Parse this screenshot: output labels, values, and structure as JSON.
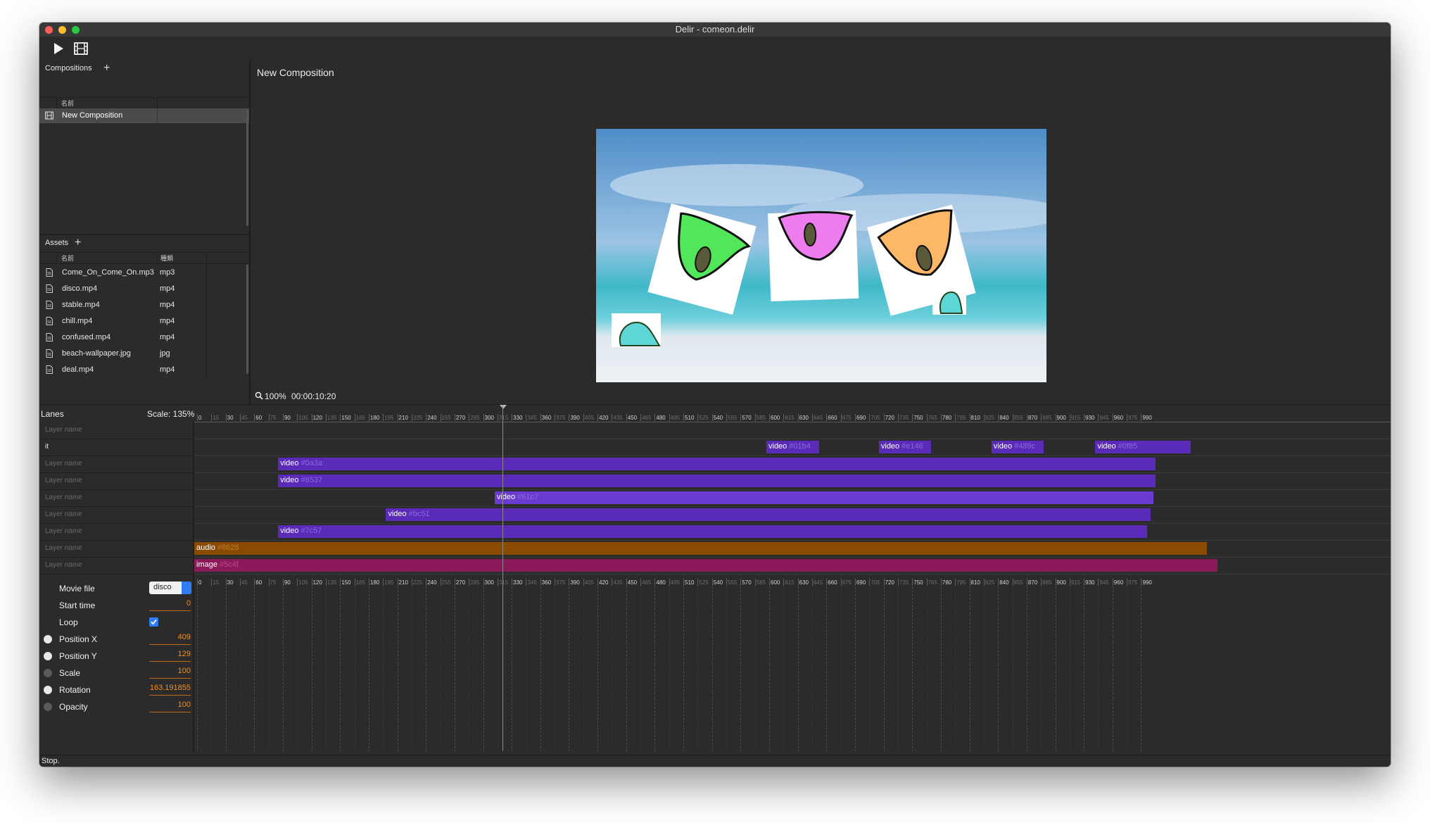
{
  "window": {
    "title": "Delir - comeon.delir"
  },
  "toolbar": {
    "play_icon": "play-icon",
    "render_icon": "film-icon"
  },
  "compositions": {
    "header": "Compositions",
    "add_label": "+",
    "column_name": "名前",
    "items": [
      {
        "name": "New Composition"
      }
    ]
  },
  "assets": {
    "header": "Assets",
    "add_label": "+",
    "columns": {
      "name": "名前",
      "type": "種類"
    },
    "items": [
      {
        "name": "Come_On_Come_On.mp3",
        "type": "mp3"
      },
      {
        "name": "disco.mp4",
        "type": "mp4"
      },
      {
        "name": "stable.mp4",
        "type": "mp4"
      },
      {
        "name": "chill.mp4",
        "type": "mp4"
      },
      {
        "name": "confused.mp4",
        "type": "mp4"
      },
      {
        "name": "beach-wallpaper.jpg",
        "type": "jpg"
      },
      {
        "name": "deal.mp4",
        "type": "mp4"
      }
    ]
  },
  "preview": {
    "title": "New Composition",
    "zoom": "100%",
    "timecode": "00:00:10:20"
  },
  "timeline": {
    "lanes_label": "Lanes",
    "scale_label": "Scale: 135%",
    "ruler_ticks": [
      "0",
      "15",
      "30",
      "45",
      "60",
      "75",
      "90",
      "105",
      "120",
      "135",
      "150",
      "165",
      "180",
      "195",
      "210",
      "225",
      "240",
      "255",
      "270",
      "285",
      "300",
      "315",
      "330",
      "345",
      "360",
      "375",
      "390",
      "405",
      "420",
      "435",
      "450",
      "465",
      "480",
      "495",
      "510",
      "525",
      "540",
      "555",
      "570",
      "585",
      "600",
      "615",
      "630",
      "645",
      "660",
      "675",
      "690",
      "705",
      "720",
      "735",
      "750",
      "765",
      "780",
      "795",
      "810",
      "825",
      "840",
      "855",
      "870",
      "885",
      "900",
      "915",
      "930",
      "945",
      "960",
      "975",
      "990"
    ],
    "layers": [
      {
        "name": "Layer name",
        "placeholder": true,
        "clips": []
      },
      {
        "name": "it",
        "placeholder": false,
        "clips": [
          {
            "type": "video",
            "id": "#01b4",
            "start": 600,
            "end": 655
          },
          {
            "type": "video",
            "id": "#e146",
            "start": 718,
            "end": 773
          },
          {
            "type": "video",
            "id": "#489c",
            "start": 836,
            "end": 891
          },
          {
            "type": "video",
            "id": "#0f85",
            "start": 945,
            "end": 1045
          }
        ]
      },
      {
        "name": "Layer name",
        "placeholder": true,
        "clips": [
          {
            "type": "video",
            "id": "#0a3a",
            "start": 88,
            "end": 1008
          }
        ]
      },
      {
        "name": "Layer name",
        "placeholder": true,
        "clips": [
          {
            "type": "video",
            "id": "#6537",
            "start": 88,
            "end": 1008
          }
        ]
      },
      {
        "name": "Layer name",
        "placeholder": true,
        "clips": [
          {
            "type": "video",
            "id": "#61c7",
            "start": 315,
            "end": 1006
          }
        ]
      },
      {
        "name": "Layer name",
        "placeholder": true,
        "clips": [
          {
            "type": "video",
            "id": "#bc51",
            "start": 201,
            "end": 1003
          }
        ]
      },
      {
        "name": "Layer name",
        "placeholder": true,
        "clips": [
          {
            "type": "video",
            "id": "#7c57",
            "start": 88,
            "end": 999
          }
        ]
      },
      {
        "name": "Layer name",
        "placeholder": true,
        "clips": [
          {
            "type": "audio",
            "id": "#8628",
            "start": 0,
            "end": 1062
          }
        ]
      },
      {
        "name": "Layer name",
        "placeholder": true,
        "clips": [
          {
            "type": "image",
            "id": "#5c4f",
            "start": 0,
            "end": 1073
          }
        ]
      }
    ],
    "playhead_frame": 320,
    "clip_colors": {
      "video": "#5a2bb8",
      "video_highlight": "#6b3ad0",
      "audio": "#8a4a00",
      "image": "#8a1a5a"
    }
  },
  "properties": [
    {
      "label": "Movie file",
      "kind": "select",
      "value": "disco",
      "keyframe": false
    },
    {
      "label": "Start time",
      "kind": "number",
      "value": "0",
      "keyframe": false
    },
    {
      "label": "Loop",
      "kind": "checkbox",
      "value": "checked",
      "keyframe": false
    },
    {
      "label": "Position X",
      "kind": "number",
      "value": "409",
      "keyframe": true
    },
    {
      "label": "Position Y",
      "kind": "number",
      "value": "129",
      "keyframe": true
    },
    {
      "label": "Scale",
      "kind": "number",
      "value": "100",
      "keyframe": false
    },
    {
      "label": "Rotation",
      "kind": "number",
      "value": "163.191855",
      "keyframe": true
    },
    {
      "label": "Opacity",
      "kind": "number",
      "value": "100",
      "keyframe": false
    }
  ],
  "status": {
    "text": "Stop."
  }
}
